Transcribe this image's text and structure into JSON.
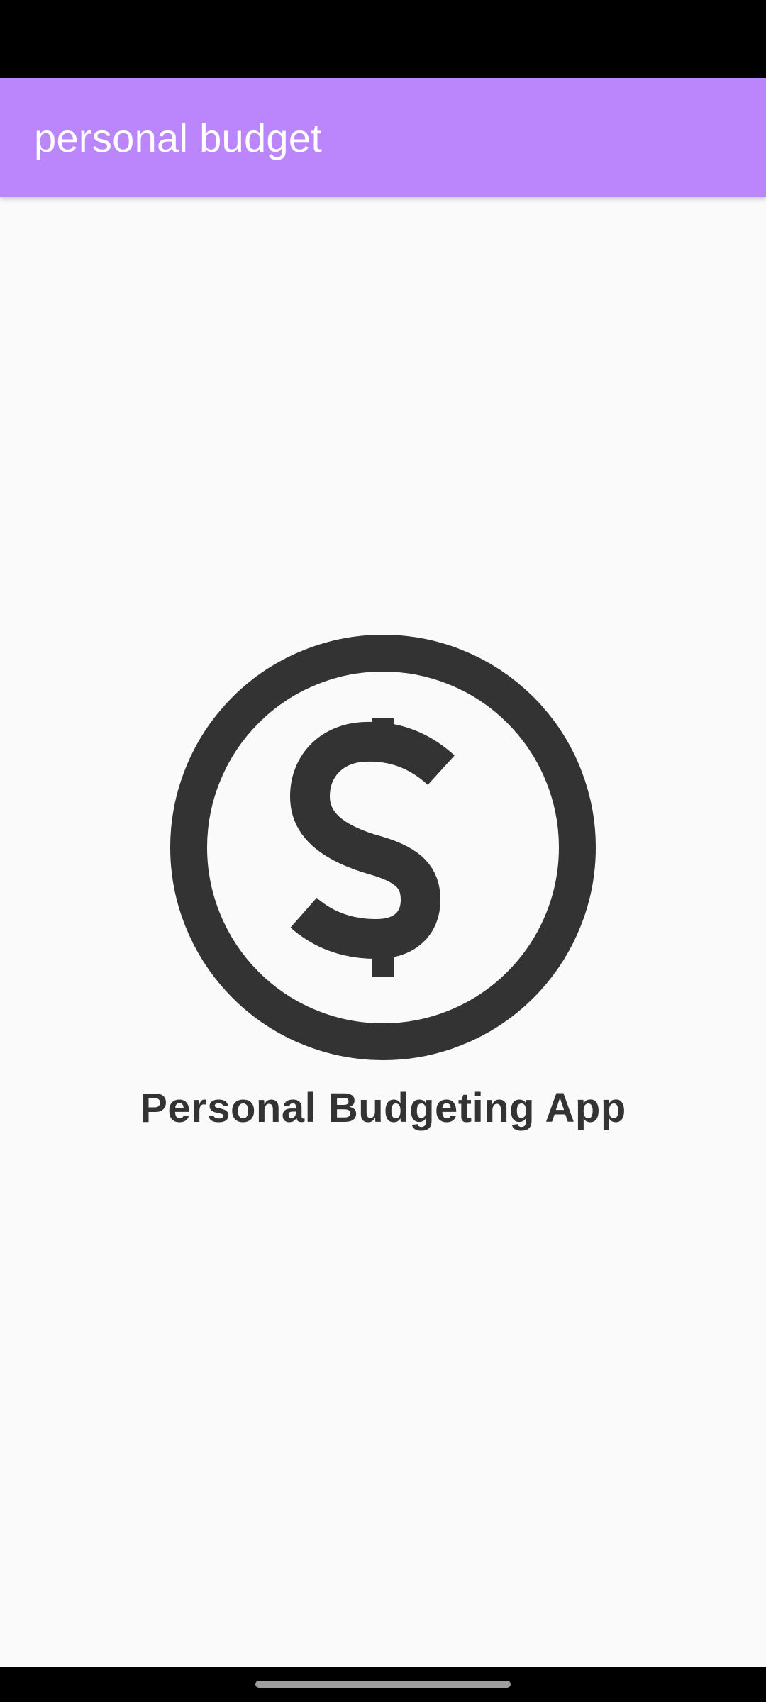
{
  "status_bar": {},
  "app_bar": {
    "title": "personal budget",
    "color": "#BB86FC"
  },
  "main": {
    "logo_icon": "dollar-circle-icon",
    "app_name": "Personal Budgeting App",
    "text_color": "#333333"
  },
  "navigation": {
    "home_indicator": "gesture-home-indicator"
  }
}
